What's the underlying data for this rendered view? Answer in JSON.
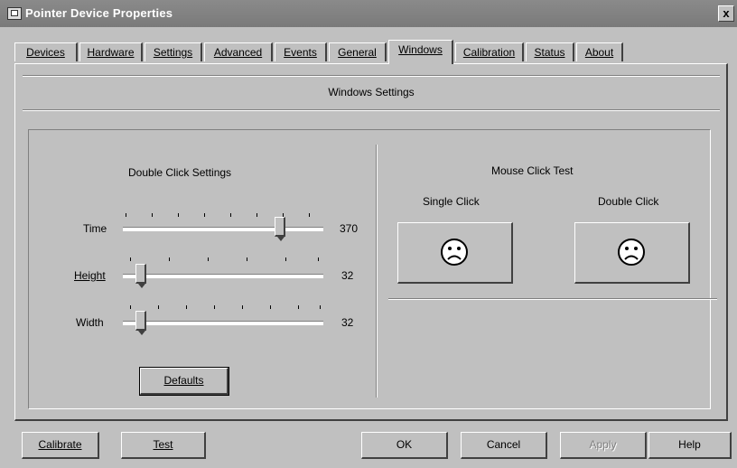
{
  "window": {
    "title": "Pointer Device Properties",
    "close_glyph": "x"
  },
  "tabs": [
    {
      "label": "Devices",
      "active": false
    },
    {
      "label": "Hardware",
      "active": false
    },
    {
      "label": "Settings",
      "active": false
    },
    {
      "label": "Advanced",
      "active": false
    },
    {
      "label": "Events",
      "active": false
    },
    {
      "label": "General",
      "active": false
    },
    {
      "label": "Windows",
      "active": true
    },
    {
      "label": "Calibration",
      "active": false
    },
    {
      "label": "Status",
      "active": false
    },
    {
      "label": "About",
      "active": false
    }
  ],
  "panel": {
    "header": "Windows Settings",
    "double_click": {
      "title": "Double Click Settings",
      "time": {
        "label": "Time",
        "value": "370"
      },
      "height": {
        "label": "Height",
        "value": "32"
      },
      "width": {
        "label": "Width",
        "value": "32"
      },
      "defaults_label": "Defaults"
    },
    "mouse_test": {
      "title": "Mouse Click Test",
      "single_label": "Single Click",
      "double_label": "Double Click",
      "face_icon": "frown-face-icon"
    }
  },
  "buttons": {
    "calibrate": "Calibrate",
    "test": "Test",
    "ok": "OK",
    "cancel": "Cancel",
    "apply": "Apply",
    "help": "Help"
  }
}
